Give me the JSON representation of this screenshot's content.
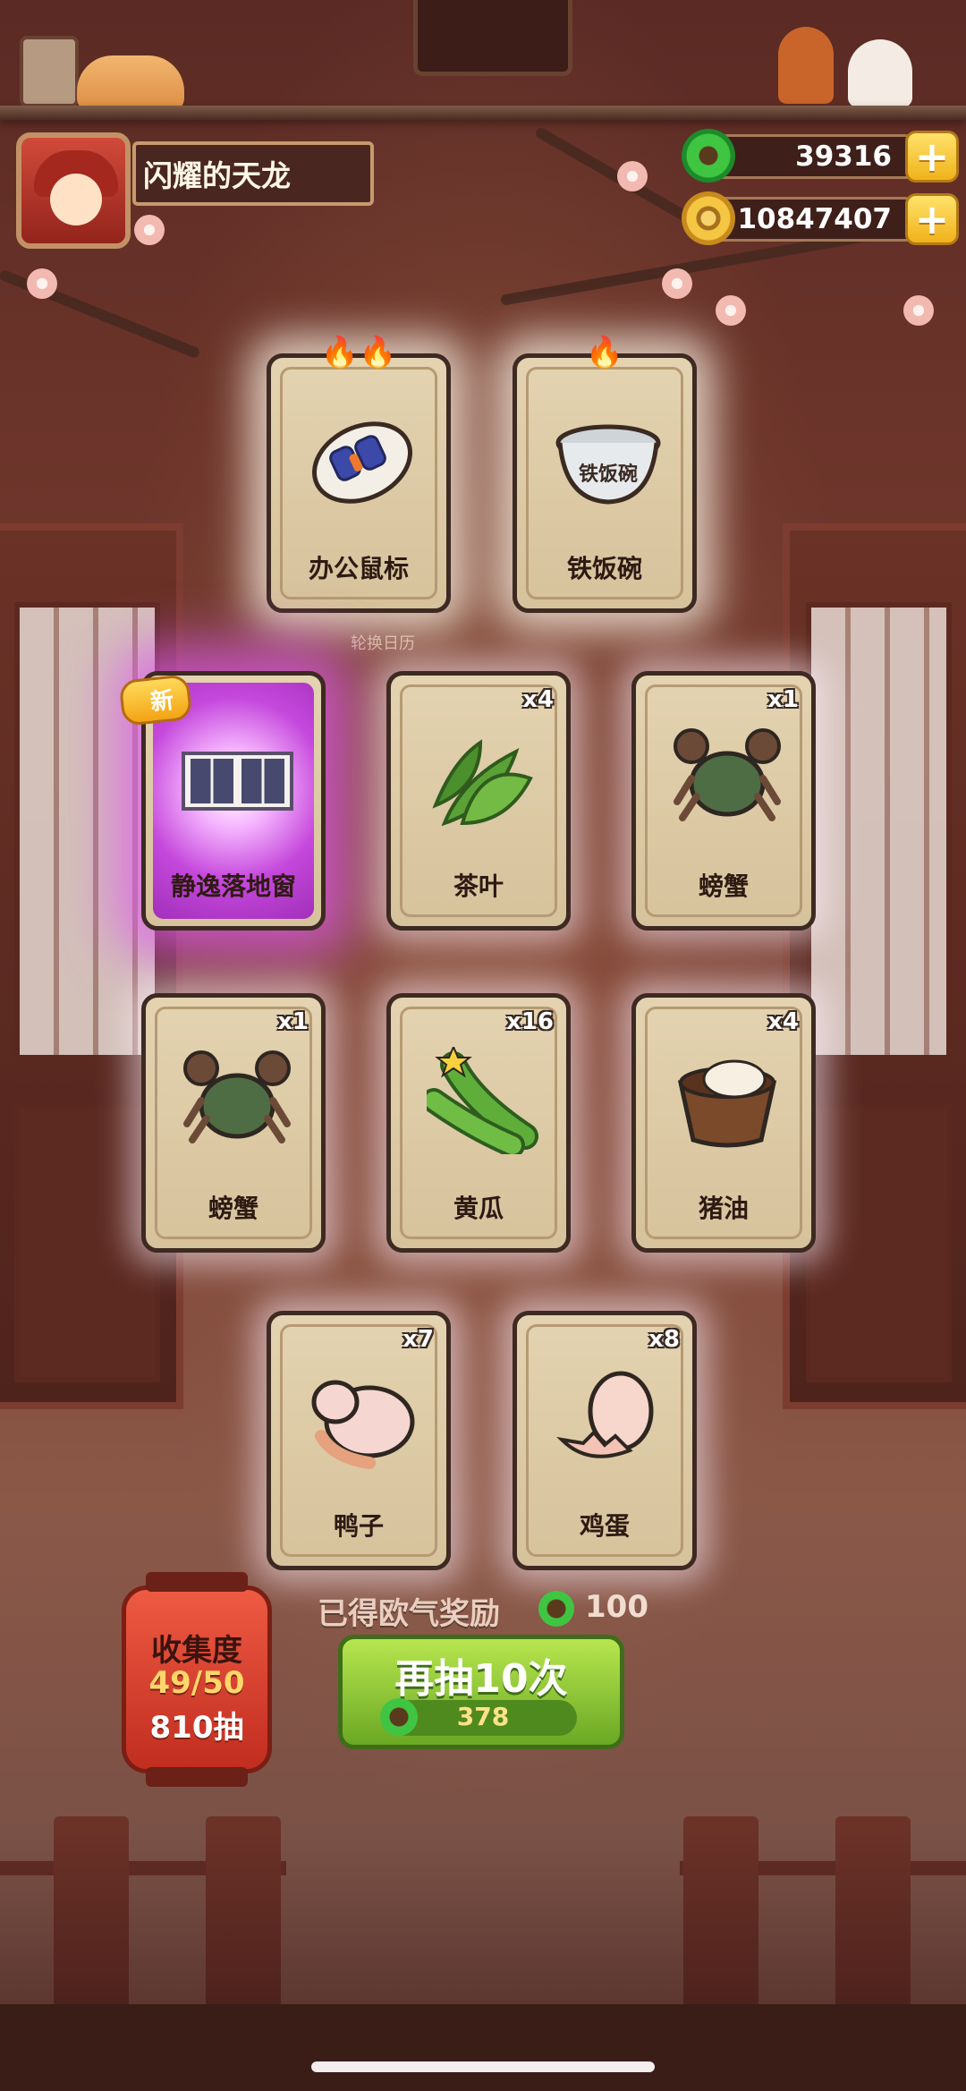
{
  "player": {
    "name": "闪耀的天龙"
  },
  "currencies": [
    {
      "name": "jade",
      "value": "39316",
      "icon": "jade-coin-icon"
    },
    {
      "name": "gold",
      "value": "10847407",
      "icon": "gold-coin-icon"
    }
  ],
  "plus_label": "+",
  "hud": {
    "calendar_label": "轮换日历"
  },
  "cards": [
    {
      "name": "办公鼠标",
      "qty": "",
      "hot": true,
      "flames": "🔥🔥",
      "icon": "mouse-icon"
    },
    {
      "name": "铁饭碗",
      "qty": "",
      "hot": true,
      "flames": "🔥",
      "icon": "iron-bowl-icon",
      "art_text": "铁饭碗"
    },
    {
      "name": "静逸落地窗",
      "qty": "",
      "is_new": true,
      "badge": "新",
      "icon": "window-icon"
    },
    {
      "name": "茶叶",
      "qty": "x4",
      "icon": "tea-leaf-icon"
    },
    {
      "name": "螃蟹",
      "qty": "x1",
      "icon": "crab-icon"
    },
    {
      "name": "螃蟹",
      "qty": "x1",
      "icon": "crab-icon"
    },
    {
      "name": "黄瓜",
      "qty": "x16",
      "icon": "cucumber-icon"
    },
    {
      "name": "猪油",
      "qty": "x4",
      "icon": "lard-icon"
    },
    {
      "name": "鸭子",
      "qty": "x7",
      "icon": "duck-icon"
    },
    {
      "name": "鸡蛋",
      "qty": "x8",
      "icon": "egg-icon"
    }
  ],
  "reward": {
    "label": "已得欧气奖励",
    "value": "100"
  },
  "draw_button": {
    "label": "再抽10次",
    "cost": "378"
  },
  "collection": {
    "title": "收集度",
    "progress": "49/50",
    "draws": "810抽"
  },
  "colors": {
    "jade": "#2fae39",
    "gold": "#f5c643",
    "button_green": "#8cc63a",
    "new_glow": "#c548dc"
  }
}
